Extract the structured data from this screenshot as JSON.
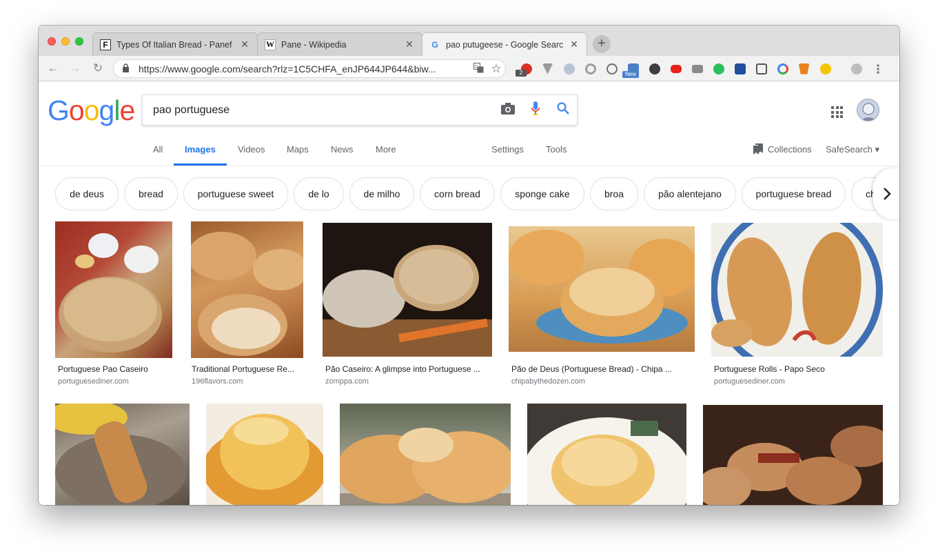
{
  "browser": {
    "tabs": [
      {
        "title": "Types Of Italian Bread - Panef",
        "favicon": "F",
        "active": false
      },
      {
        "title": "Pane - Wikipedia",
        "favicon": "W",
        "active": false
      },
      {
        "title": "pao putugeese - Google Searc",
        "favicon": "G",
        "active": true
      }
    ],
    "close_glyph": "✕",
    "new_tab_glyph": "+",
    "url": "https://www.google.com/search?rlz=1C5CHFA_enJP644JP644&biw...",
    "back_glyph": "←",
    "forward_glyph": "→",
    "reload_glyph": "↻",
    "extensions": [
      {
        "icon": "adblock-icon",
        "color": "#d93025"
      },
      {
        "icon": "vimium-icon",
        "color": "#9a9a9a"
      },
      {
        "icon": "react-devtools-icon",
        "color": "#b8c4d6"
      },
      {
        "icon": "circle-ext-icon",
        "color": "#9e9e9e"
      },
      {
        "icon": "chat-icon",
        "color": "#6f6f6f"
      },
      {
        "icon": "new-badge-icon",
        "color": "#4a7fc9"
      },
      {
        "icon": "globe-icon",
        "color": "#3d3d3d"
      },
      {
        "icon": "youtube-icon",
        "color": "#e62117"
      },
      {
        "icon": "camera-ext-icon",
        "color": "#8a8a8a"
      },
      {
        "icon": "evernote-icon",
        "color": "#2dbe60"
      },
      {
        "icon": "m-ext-icon",
        "color": "#1f4e9c"
      },
      {
        "icon": "s-ext-icon",
        "color": "#555555"
      },
      {
        "icon": "google-ext-icon",
        "color": "#4285f4"
      },
      {
        "icon": "metamask-icon",
        "color": "#e8821e"
      },
      {
        "icon": "yellow-ext-icon",
        "color": "#f5c400"
      },
      {
        "icon": "profile-icon",
        "color": "#9e9e9e"
      },
      {
        "icon": "menu-dots-icon",
        "color": "#7a7a7a"
      }
    ],
    "ext_badges": {
      "abp_count": "2",
      "new_label": "New"
    }
  },
  "google": {
    "logo": [
      "G",
      "o",
      "o",
      "g",
      "l",
      "e"
    ],
    "query": "pao portuguese",
    "nav_tabs": [
      "All",
      "Images",
      "Videos",
      "Maps",
      "News",
      "More"
    ],
    "active_tab": "Images",
    "settings_label": "Settings",
    "tools_label": "Tools",
    "collections_label": "Collections",
    "safesearch_label": "SafeSearch ▾",
    "chips": [
      "de deus",
      "bread",
      "portuguese sweet",
      "de lo",
      "de milho",
      "corn bread",
      "sponge cake",
      "broa",
      "pão alentejano",
      "portuguese bread",
      "ch"
    ]
  },
  "results": [
    {
      "title": "Portuguese Pao Caseiro",
      "site": "portuguesediner.com"
    },
    {
      "title": "Traditional Portuguese Re...",
      "site": "196flavors.com"
    },
    {
      "title": "Pão Caseiro: A glimpse into Portuguese ...",
      "site": "zomppa.com"
    },
    {
      "title": "Pão de Deus (Portuguese Bread) - Chipa ...",
      "site": "chipabythedozen.com"
    },
    {
      "title": "Portuguese Rolls - Papo Seco",
      "site": "portuguesediner.com"
    }
  ]
}
